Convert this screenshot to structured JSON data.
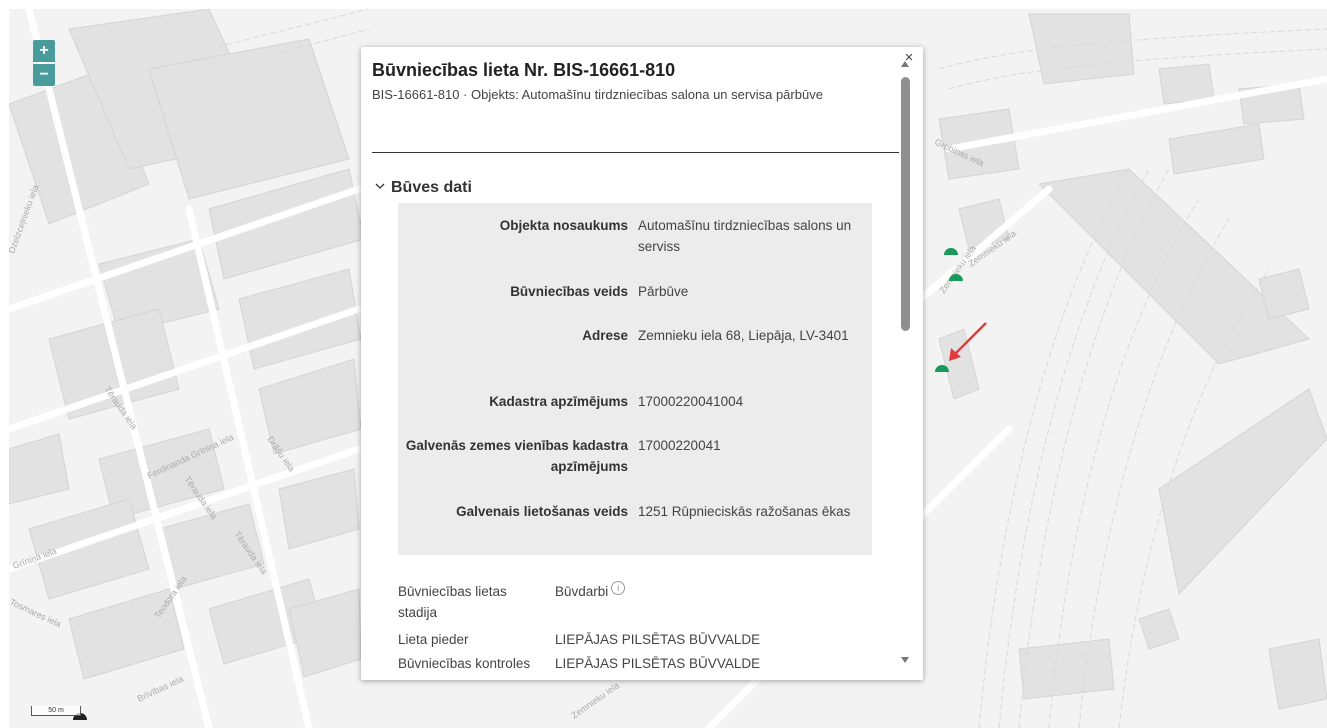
{
  "map": {
    "street_labels": [
      "Tērauda iela",
      "Ferdinanda Grīniņa iela",
      "Tērauda iela",
      "Dzelzceļnieku iela",
      "Drāšu iela",
      "Grīniņa iela",
      "Tērauda iela",
      "Teodora iela",
      "Tosmares iela",
      "Brīvības iela",
      "Zemnieku iela",
      "Zemnieku iela",
      "Grobiņas iela",
      "Zemnieku iela"
    ],
    "scale_label": "50 m",
    "marker_color": "#1a9a5a",
    "arrow_color": "#e23b3b"
  },
  "zoom": {
    "in": "+",
    "out": "−"
  },
  "popup": {
    "title": "Būvniecības lieta Nr. BIS-16661-810",
    "subtitle": "BIS-16661-810 · Objekts: Automašīnu tirdzniecības salona un servisa pārbūve",
    "close": "×",
    "section_title": "Būves dati",
    "fields": [
      {
        "label": "Objekta nosaukums",
        "value": "Automašīnu tirdzniecības salons un serviss"
      },
      {
        "label": "Būvniecības veids",
        "value": "Pārbūve"
      },
      {
        "label": "Adrese",
        "value": "Zemnieku iela 68, Liepāja, LV-3401"
      },
      {
        "label": "Kadastra apzīmējums",
        "value": "17000220041004"
      },
      {
        "label": "Galvenās zemes vienības kadastra apzīmējums",
        "value": "17000220041"
      },
      {
        "label": "Galvenais lietošanas veids",
        "value": "1251 Rūpnieciskās ražošanas ēkas"
      }
    ],
    "details": [
      {
        "label": "Būvniecības lietas stadija",
        "value": "Būvdarbi"
      },
      {
        "label": "Lieta pieder",
        "value": "LIEPĀJAS PILSĒTAS BŪVVALDE"
      },
      {
        "label": "Būvniecības kontroles",
        "value": "LIEPĀJAS PILSĒTAS BŪVVALDE"
      }
    ],
    "info_icon": "i"
  }
}
